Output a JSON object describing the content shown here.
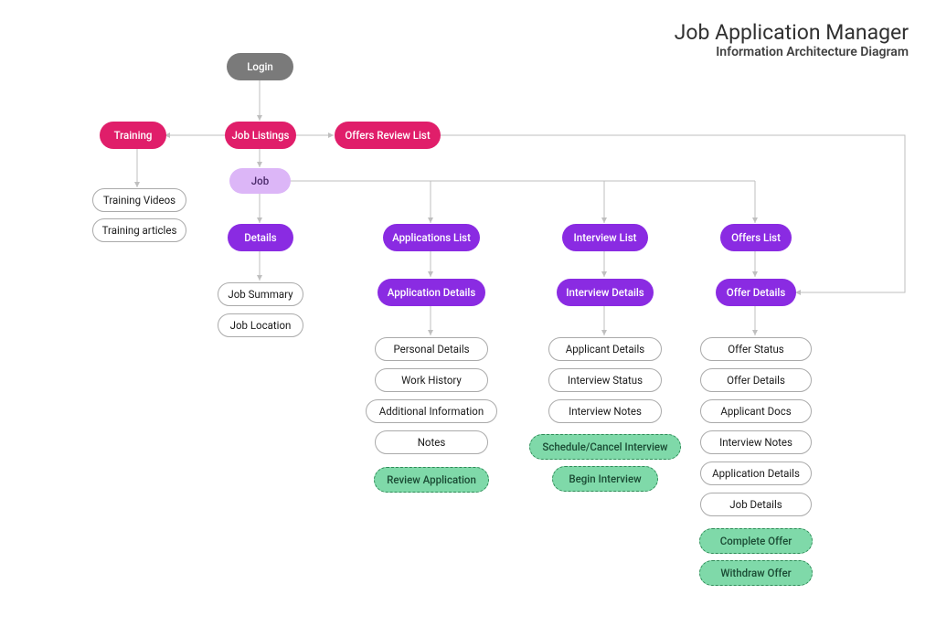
{
  "title": "Job Application Manager",
  "subtitle": "Information Architecture Diagram",
  "nodes": {
    "login": "Login",
    "training": "Training",
    "job_listings": "Job Listings",
    "offers_review_list": "Offers Review List",
    "training_videos": "Training Videos",
    "training_articles": "Training articles",
    "job": "Job",
    "details": "Details",
    "applications_list": "Applications List",
    "interview_list": "Interview List",
    "offers_list": "Offers List",
    "job_summary": "Job Summary",
    "job_location": "Job Location",
    "application_details": "Application Details",
    "interview_details": "Interview Details",
    "offer_details_hdr": "Offer Details",
    "personal_details": "Personal Details",
    "work_history": "Work History",
    "additional_information": "Additional Information",
    "notes": "Notes",
    "review_application": "Review Application",
    "applicant_details": "Applicant Details",
    "interview_status": "Interview Status",
    "interview_notes": "Interview Notes",
    "schedule_cancel_interview": "Schedule/Cancel Interview",
    "begin_interview": "Begin Interview",
    "offer_status": "Offer Status",
    "offer_details": "Offer Details",
    "applicant_docs": "Applicant Docs",
    "interview_notes2": "Interview Notes",
    "application_details2": "Application Details",
    "job_details": "Job Details",
    "complete_offer": "Complete Offer",
    "withdraw_offer": "Withdraw Offer"
  }
}
